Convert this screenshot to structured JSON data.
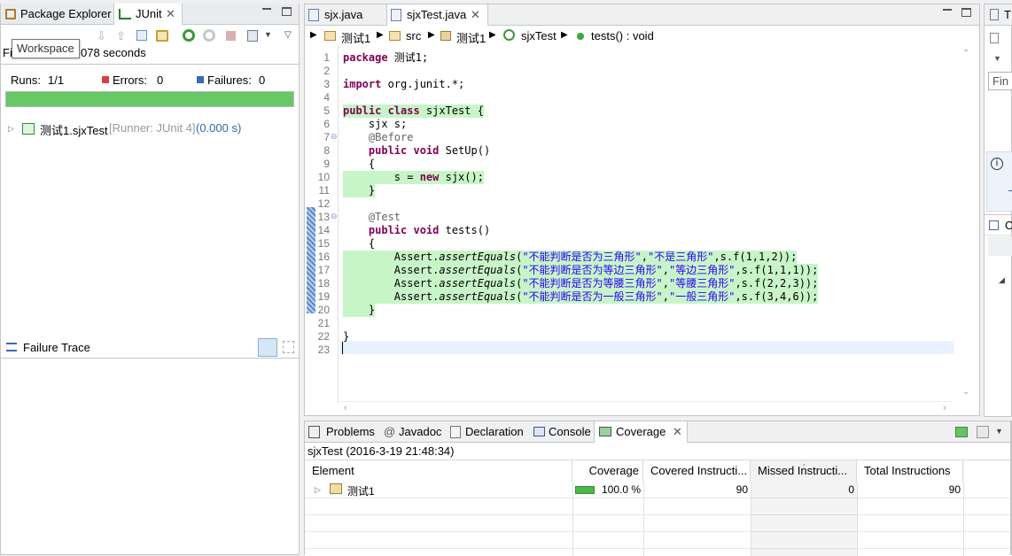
{
  "left": {
    "tabs": [
      {
        "label": "Package Explorer"
      },
      {
        "label": "JUnit"
      }
    ],
    "tooltip": "Workspace",
    "finished_prefix": "Fi",
    "finished_suffix": "078 seconds",
    "runs_label": "Runs:",
    "runs_value": "1/1",
    "errors_label": "Errors:",
    "errors_value": "0",
    "failures_label": "Failures:",
    "failures_value": "0",
    "progress_fraction": 1.0,
    "progress_color": "#66c966",
    "test_name": "测试1.sjxTest",
    "test_runner": "[Runner: JUnit 4]",
    "test_time": "(0.000 s)",
    "failure_trace_label": "Failure Trace"
  },
  "editor": {
    "tabs": [
      {
        "label": "sjx.java"
      },
      {
        "label": "sjxTest.java"
      }
    ],
    "breadcrumb": [
      "测试1",
      "src",
      "测试1",
      "sjxTest",
      "tests() : void"
    ],
    "lines": [
      {
        "n": "1",
        "segs": [
          {
            "t": "package ",
            "c": "kw"
          },
          {
            "t": "测试1;",
            "c": ""
          }
        ],
        "hl": false
      },
      {
        "n": "2",
        "segs": [],
        "hl": false
      },
      {
        "n": "3",
        "segs": [
          {
            "t": "import ",
            "c": "kw"
          },
          {
            "t": "org.junit.*;",
            "c": ""
          }
        ],
        "hl": false
      },
      {
        "n": "4",
        "segs": [],
        "hl": false
      },
      {
        "n": "5",
        "segs": [
          {
            "t": "public class ",
            "c": "kw"
          },
          {
            "t": "sjxTest {",
            "c": ""
          }
        ],
        "hl": true
      },
      {
        "n": "6",
        "segs": [
          {
            "t": "    sjx s;",
            "c": ""
          }
        ],
        "hl": false
      },
      {
        "n": "7",
        "segs": [
          {
            "t": "    @Before",
            "c": "ann"
          }
        ],
        "hl": false,
        "fold": true
      },
      {
        "n": "8",
        "segs": [
          {
            "t": "    ",
            "c": ""
          },
          {
            "t": "public void ",
            "c": "kw"
          },
          {
            "t": "SetUp()",
            "c": ""
          }
        ],
        "hl": false
      },
      {
        "n": "9",
        "segs": [
          {
            "t": "    {",
            "c": ""
          }
        ],
        "hl": false
      },
      {
        "n": "10",
        "segs": [
          {
            "t": "        s = ",
            "c": ""
          },
          {
            "t": "new ",
            "c": "kw"
          },
          {
            "t": "sjx();",
            "c": ""
          }
        ],
        "hl": true
      },
      {
        "n": "11",
        "segs": [
          {
            "t": "    }",
            "c": ""
          }
        ],
        "hl": true
      },
      {
        "n": "12",
        "segs": [],
        "hl": false
      },
      {
        "n": "13",
        "segs": [
          {
            "t": "    @Test",
            "c": "ann"
          }
        ],
        "hl": false,
        "fold": true
      },
      {
        "n": "14",
        "segs": [
          {
            "t": "    ",
            "c": ""
          },
          {
            "t": "public void ",
            "c": "kw"
          },
          {
            "t": "tests()",
            "c": ""
          }
        ],
        "hl": false
      },
      {
        "n": "15",
        "segs": [
          {
            "t": "    {",
            "c": ""
          }
        ],
        "hl": false
      },
      {
        "n": "16",
        "segs": [
          {
            "t": "        Assert.",
            "c": ""
          },
          {
            "t": "assertEquals",
            "c": "it"
          },
          {
            "t": "(",
            "c": ""
          },
          {
            "t": "\"不能判断是否为三角形\"",
            "c": "str"
          },
          {
            "t": ",",
            "c": ""
          },
          {
            "t": "\"不是三角形\"",
            "c": "str"
          },
          {
            "t": ",s.f(1,1,2));",
            "c": ""
          }
        ],
        "hl": true
      },
      {
        "n": "17",
        "segs": [
          {
            "t": "        Assert.",
            "c": ""
          },
          {
            "t": "assertEquals",
            "c": "it"
          },
          {
            "t": "(",
            "c": ""
          },
          {
            "t": "\"不能判断是否为等边三角形\"",
            "c": "str"
          },
          {
            "t": ",",
            "c": ""
          },
          {
            "t": "\"等边三角形\"",
            "c": "str"
          },
          {
            "t": ",s.f(1,1,1));",
            "c": ""
          }
        ],
        "hl": true
      },
      {
        "n": "18",
        "segs": [
          {
            "t": "        Assert.",
            "c": ""
          },
          {
            "t": "assertEquals",
            "c": "it"
          },
          {
            "t": "(",
            "c": ""
          },
          {
            "t": "\"不能判断是否为等腰三角形\"",
            "c": "str"
          },
          {
            "t": ",",
            "c": ""
          },
          {
            "t": "\"等腰三角形\"",
            "c": "str"
          },
          {
            "t": ",s.f(2,2,3));",
            "c": ""
          }
        ],
        "hl": true
      },
      {
        "n": "19",
        "segs": [
          {
            "t": "        Assert.",
            "c": ""
          },
          {
            "t": "assertEquals",
            "c": "it"
          },
          {
            "t": "(",
            "c": ""
          },
          {
            "t": "\"不能判断是否为一般三角形\"",
            "c": "str"
          },
          {
            "t": ",",
            "c": ""
          },
          {
            "t": "\"一般三角形\"",
            "c": "str"
          },
          {
            "t": ",s.f(3,4,6));",
            "c": ""
          }
        ],
        "hl": true
      },
      {
        "n": "20",
        "segs": [
          {
            "t": "    }",
            "c": ""
          }
        ],
        "hl": true
      },
      {
        "n": "21",
        "segs": [],
        "hl": false
      },
      {
        "n": "22",
        "segs": [
          {
            "t": "}",
            "c": ""
          }
        ],
        "hl": false
      },
      {
        "n": "23",
        "segs": [],
        "hl": false,
        "current": true
      }
    ],
    "highlight_color": "#c8f5c8"
  },
  "bottom": {
    "tabs": [
      {
        "label": "Problems"
      },
      {
        "label": "Javadoc"
      },
      {
        "label": "Declaration"
      },
      {
        "label": "Console"
      },
      {
        "label": "Coverage"
      }
    ],
    "session": "sjxTest (2016-3-19 21:48:34)",
    "columns": [
      "Element",
      "Coverage",
      "Covered Instructi...",
      "Missed Instructi...",
      "Total Instructions"
    ],
    "rows": [
      {
        "element": "测试1",
        "coverage": "100.0 %",
        "covered": "90",
        "missed": "0",
        "total": "90",
        "coverage_fraction": 1.0
      }
    ]
  },
  "right": {
    "tab_letter": "T",
    "field_text": "Fin",
    "section_letter": "C"
  }
}
